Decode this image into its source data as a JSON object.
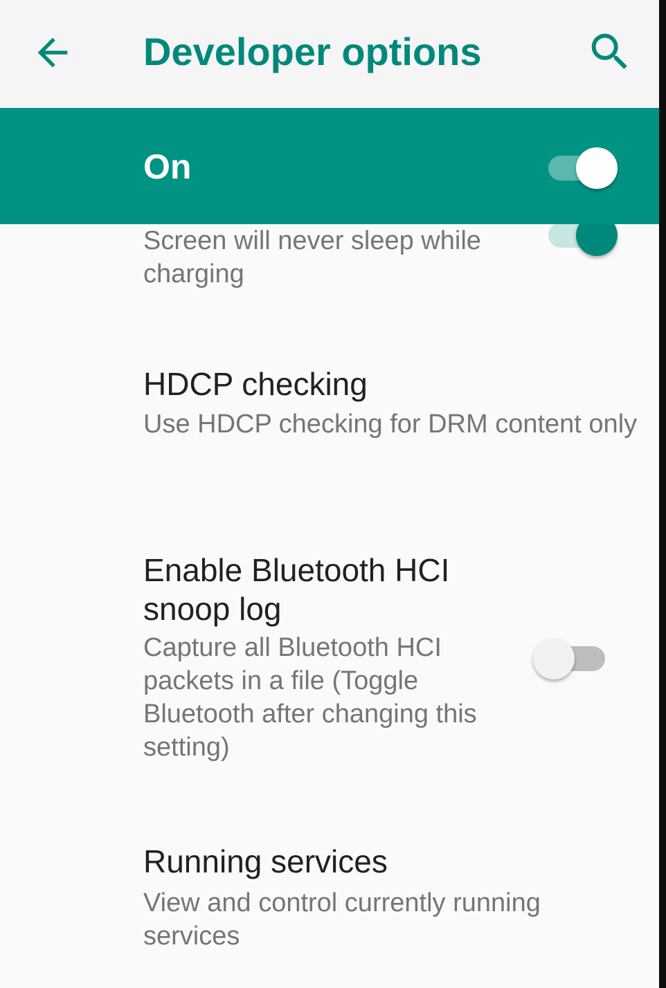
{
  "app_bar": {
    "title": "Developer options",
    "back_icon": "arrow-back-icon",
    "search_icon": "search-icon",
    "accent_color": "#00897b"
  },
  "master_switch": {
    "label": "On",
    "checked": true,
    "background_color": "#009384"
  },
  "settings": [
    {
      "title": "",
      "summary": "Screen will never sleep while charging",
      "switch_checked": true
    },
    {
      "title": "HDCP checking",
      "summary": "Use HDCP checking for DRM content only"
    },
    {
      "title": "Enable Bluetooth HCI snoop log",
      "summary": "Capture all Bluetooth HCI packets in a file (Toggle Bluetooth after changing this setting)",
      "switch_checked": false
    },
    {
      "title": "Running services",
      "summary": "View and control currently running services"
    }
  ]
}
